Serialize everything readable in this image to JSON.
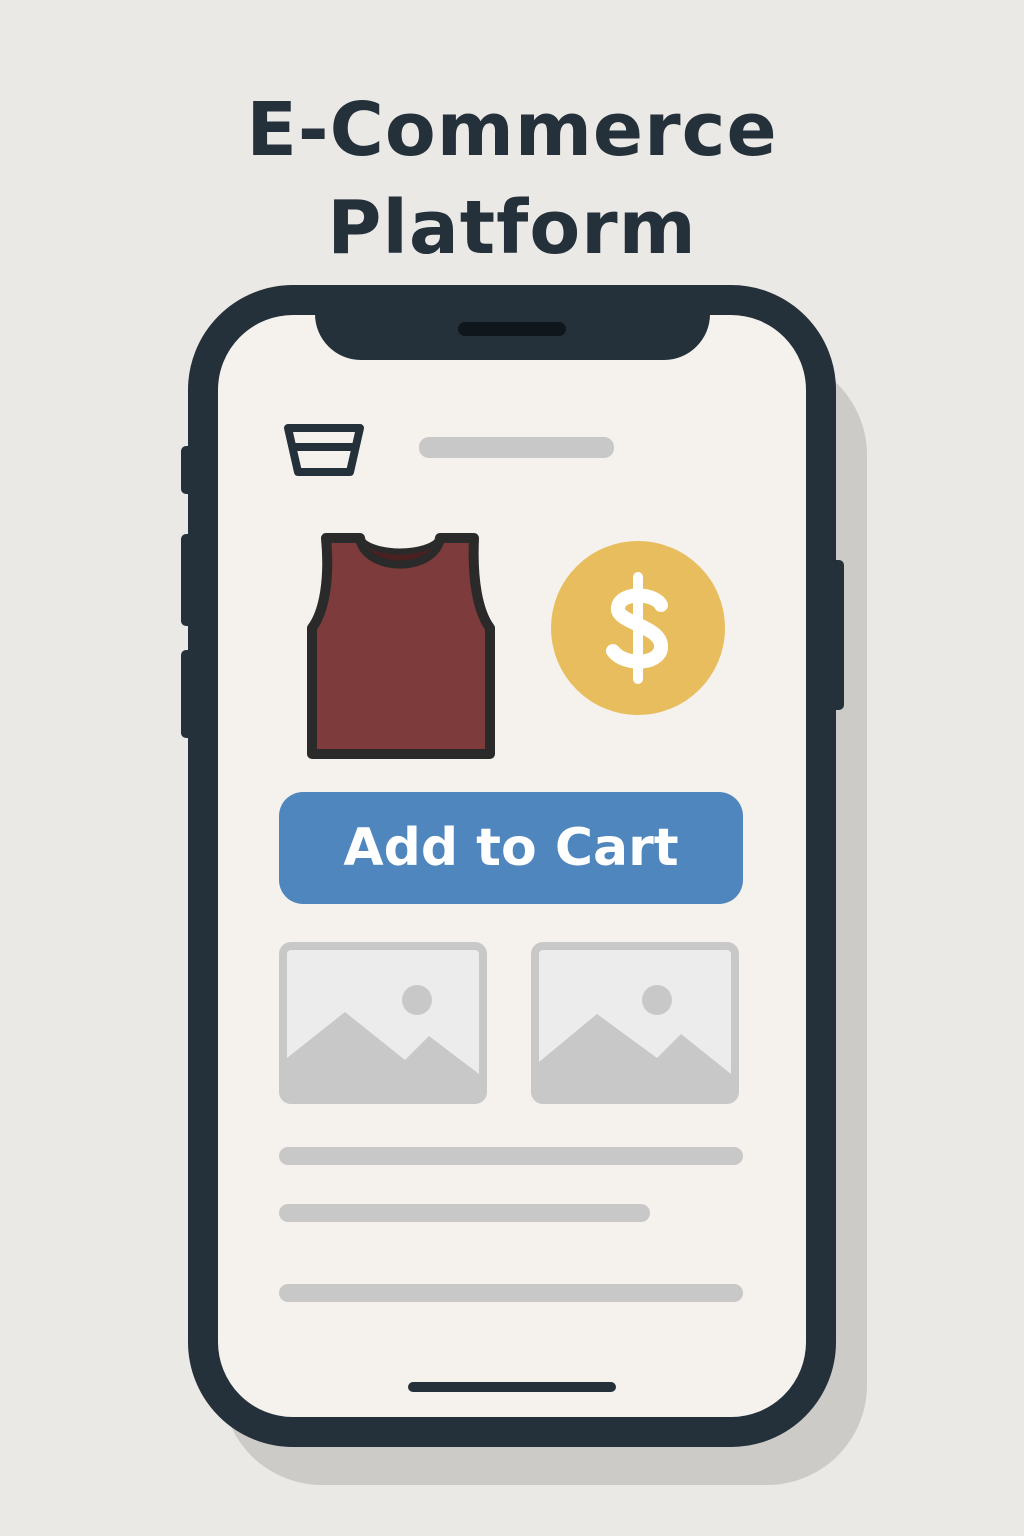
{
  "title": {
    "line1": "E-Commerce",
    "line2": "Platform"
  },
  "screen": {
    "cart_icon": "shopping-basket-icon",
    "product_icon": "tank-top-icon",
    "price_icon": "dollar-coin-icon",
    "add_to_cart_label": "Add to Cart",
    "image_placeholders": [
      "image-placeholder-icon",
      "image-placeholder-icon"
    ]
  },
  "colors": {
    "background": "#ebe9e5",
    "phone_frame": "#24303a",
    "screen": "#f5f2ed",
    "button": "#4f86bd",
    "coin": "#e7bd5e",
    "product": "#7d3b3b",
    "placeholder": "#c8c8c8"
  }
}
